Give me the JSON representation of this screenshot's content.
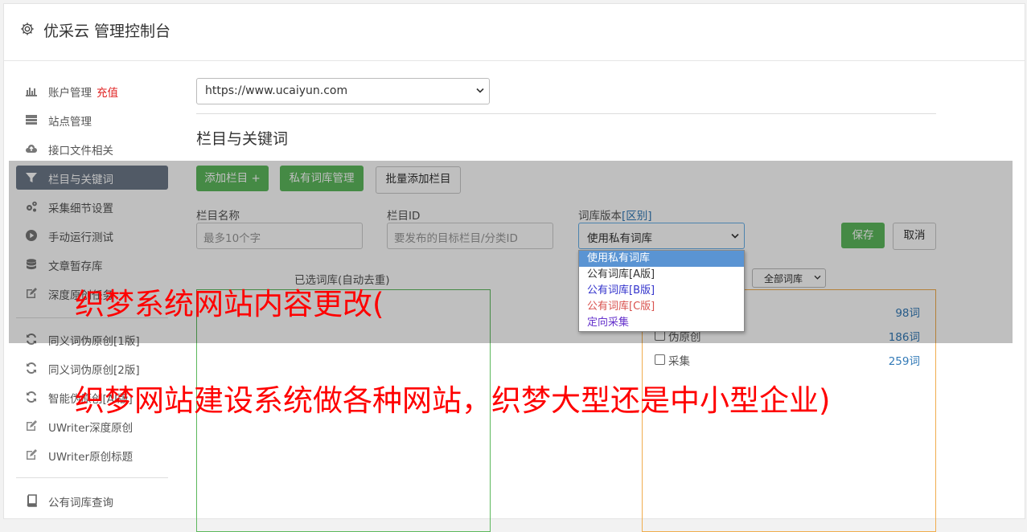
{
  "app": {
    "title": "优采云 管理控制台"
  },
  "sidebar": {
    "items": [
      {
        "label": "账户管理",
        "badge": "充值"
      },
      {
        "label": "站点管理"
      },
      {
        "label": "接口文件相关"
      },
      {
        "label": "栏目与关键词"
      },
      {
        "label": "采集细节设置"
      },
      {
        "label": "手动运行测试"
      },
      {
        "label": "文章暂存库"
      },
      {
        "label": "深度原创任务"
      },
      {
        "label": "同义词伪原创[1版]"
      },
      {
        "label": "同义词伪原创[2版]"
      },
      {
        "label": "智能伪原创[AI版]"
      },
      {
        "label": "UWriter深度原创"
      },
      {
        "label": "UWriter原创标题"
      },
      {
        "label": "公有词库查询"
      }
    ]
  },
  "site_select": {
    "value": "https://www.ucaiyun.com"
  },
  "section": {
    "title": "栏目与关键词"
  },
  "toolbar": {
    "add_column": "添加栏目 +",
    "private_lib": "私有词库管理",
    "batch_add": "批量添加栏目"
  },
  "form": {
    "column_name_label": "栏目名称",
    "column_name_placeholder": "最多10个字",
    "column_id_label": "栏目ID",
    "column_id_placeholder": "要发布的目标栏目/分类ID",
    "lib_version_label": "词库版本",
    "lib_version_link": "[区别]",
    "lib_version_value": "使用私有词库",
    "save": "保存",
    "cancel": "取消"
  },
  "dropdown": {
    "options": [
      {
        "label": "使用私有词库",
        "color": "#ffffff"
      },
      {
        "label": "公有词库[A版]",
        "color": "#333333"
      },
      {
        "label": "公有词库[B版]",
        "color": "#3333cc"
      },
      {
        "label": "公有词库[C版]",
        "color": "#d9534f"
      },
      {
        "label": "定向采集",
        "color": "#6633cc"
      }
    ]
  },
  "selected_panel": {
    "title": "已选词库(自动去重)"
  },
  "lib_filter": {
    "value": "全部词库"
  },
  "libraries": [
    {
      "name": "",
      "count": "98词"
    },
    {
      "name": "伪原创",
      "count": "186词"
    },
    {
      "name": "采集",
      "count": "259词"
    }
  ],
  "watermarks": {
    "line1": "织梦系统网站内容更改(",
    "line2": "织梦网站建设系统做各种网站，织梦大型还是中小型企业)"
  },
  "colors": {
    "green": "#5cb85c",
    "orange": "#f0ad4e",
    "blue": "#337ab7",
    "active_nav": "#6c7989",
    "watermark": "#ff0000"
  }
}
